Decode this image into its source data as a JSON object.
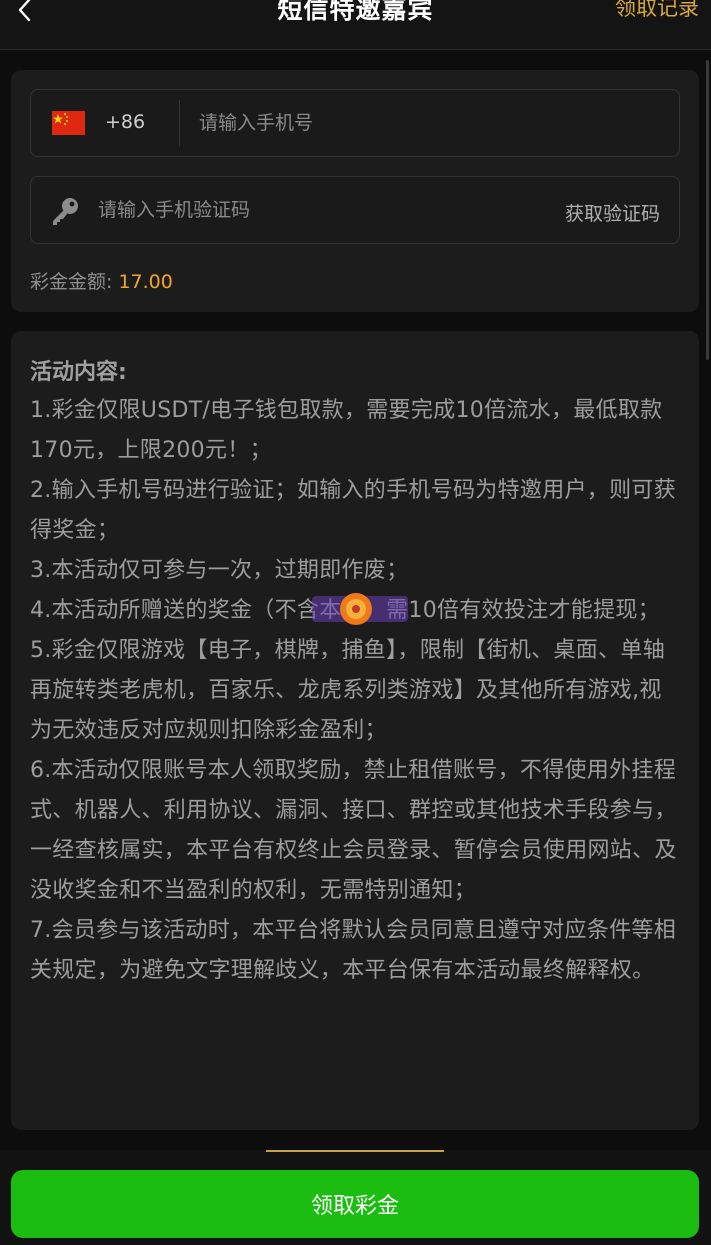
{
  "header": {
    "title": "短信特邀嘉宾",
    "records_label": "领取记录"
  },
  "form": {
    "country_code": "+86",
    "phone_placeholder": "请输入手机号",
    "code_placeholder": "请输入手机验证码",
    "get_code_label": "获取验证码",
    "bonus_label": "彩金金额:",
    "bonus_value": "17.00"
  },
  "activity": {
    "title": "活动内容:",
    "rules": [
      "1.彩金仅限USDT/电子钱包取款，需要完成10倍流水，最低取款170元，上限200元！；",
      "2.输入手机号码进行验证；如输入的手机号码为特邀用户，则可获得奖金；",
      "3.本活动仅可参与一次，过期即作废；",
      "4.本活动所赠送的奖金（不含本金）需10倍有效投注才能提现；",
      "5.彩金仅限游戏【电子，棋牌，捕鱼】，限制【街机、桌面、单轴再旋转类老虎机，百家乐、龙虎系列类游戏】及其他所有游戏,视为无效违反对应规则扣除彩金盈利；",
      "6.本活动仅限账号本人领取奖励，禁止租借账号，不得使用外挂程式、机器人、利用协议、漏洞、接口、群控或其他技术手段参与，一经查核属实，本平台有权终止会员登录、暂停会员使用网站、及没收奖金和不当盈利的权利，无需特别通知；",
      "7.会员参与该活动时，本平台将默认会员同意且遵守对应条件等相关规定，为避免文字理解歧义，本平台保有本活动最终解释权。"
    ]
  },
  "footer": {
    "claim_label": "领取彩金"
  },
  "colors": {
    "accent_gold": "#d8a93c",
    "bonus_orange": "#f2a628",
    "button_green": "#1bbd10"
  },
  "icons": [
    "back-arrow-icon",
    "china-flag-icon",
    "key-icon",
    "watermark-badge-icon"
  ]
}
